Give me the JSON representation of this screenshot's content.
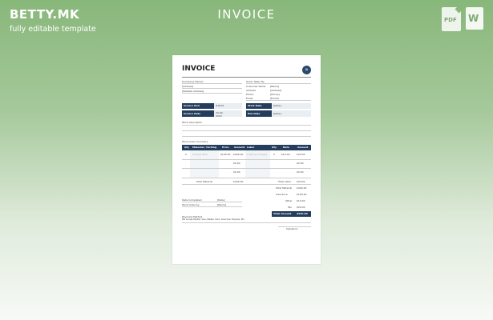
{
  "header": {
    "brand": "BETTY.MK",
    "tagline": "fully editable template",
    "title": "INVOICE",
    "icons": [
      "pdf-file-icon",
      "word-file-icon"
    ],
    "pdf_label": "PDF",
    "word_label": "W"
  },
  "invoice": {
    "title": "INVOICE",
    "company_block": [
      "[Company Name]",
      "[Address]",
      "[Website Address]"
    ],
    "order_taken_by": "Order Taken By",
    "customer_fields": [
      {
        "label": "Customer Name",
        "value": "[Name]"
      },
      {
        "label": "Address",
        "value": "[Address]"
      },
      {
        "label": "Phone",
        "value": "[Phone]"
      },
      {
        "label": "Email",
        "value": "[Email]"
      }
    ],
    "invoice_no_label": "Invoice No#",
    "invoice_no_value": "#1879",
    "invoice_date_label": "Invoice Date",
    "invoice_date_value": "23-02-2019",
    "start_date_label": "Start Date",
    "start_date_value": "[Date]",
    "end_date_label": "End Date",
    "end_date_value": "[Date]",
    "work_description": "Work description",
    "work_order_summary": "Work Order Summary",
    "table_headers": [
      "Qty",
      "Material / Parking",
      "Price",
      "Amount",
      "Labor",
      "Qty",
      "Rate",
      "Amount"
    ],
    "rows": [
      [
        "2",
        "Sample item",
        "$100.00",
        "$400.00",
        "Loading Charges",
        "2",
        "$10.00",
        "$20.00"
      ],
      [
        "",
        "",
        "",
        "$0.00",
        "",
        "",
        "",
        "$0.00"
      ],
      [
        "",
        "",
        "",
        "$0.00",
        "",
        "",
        "",
        "$0.00"
      ]
    ],
    "total_material_label": "Total Material",
    "total_material_value": "$400.00",
    "total_labor_label": "Total Labor",
    "total_labor_value": "$20.00",
    "summary": [
      {
        "label": "Total Material",
        "value": "$400.00"
      },
      {
        "label": "Insurance",
        "value": "$100.00"
      },
      {
        "label": "Other",
        "value": "$10.00"
      },
      {
        "label": "Tax",
        "value": "$20.00"
      }
    ],
    "total_amount_label": "Total Amount",
    "total_amount_value": "$530.00",
    "date_completed_label": "Date Completed",
    "date_completed_value": "[Date]",
    "work_order_by_label": "Work Order by",
    "work_order_by_value": "[Name]",
    "payment_method_label": "Payment Method",
    "payment_method_value": "We accept PayPal, Visa, Master Card, American Express, Etc.",
    "signature_label": "Signature"
  }
}
